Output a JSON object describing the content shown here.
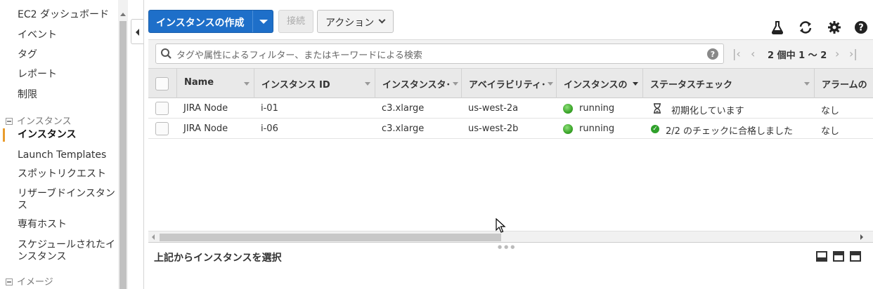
{
  "sidebar": {
    "items": [
      {
        "label": "EC2 ダッシュボード"
      },
      {
        "label": "イベント"
      },
      {
        "label": "タグ"
      },
      {
        "label": "レポート"
      },
      {
        "label": "制限"
      }
    ],
    "section_instances": "インスタンス",
    "instance_items": [
      {
        "label": "インスタンス"
      },
      {
        "label": "Launch Templates"
      },
      {
        "label": "スポットリクエスト"
      },
      {
        "label": "リザーブドインスタン"
      },
      {
        "label": "ス"
      },
      {
        "label": "専有ホスト"
      },
      {
        "label": "スケジュールされたイ"
      },
      {
        "label": "ンスタンス"
      }
    ],
    "section_images": "イメージ"
  },
  "toolbar": {
    "create_label": "インスタンスの作成",
    "connect_label": "接続",
    "actions_label": "アクション",
    "icons": [
      "flask-icon",
      "refresh-icon",
      "gear-icon",
      "help-icon"
    ]
  },
  "search": {
    "placeholder": "タグや属性によるフィルター、またはキーワードによる検索"
  },
  "pager": {
    "text": "2 個中 1 〜 2"
  },
  "table": {
    "columns": [
      "Name",
      "インスタンス ID",
      "インスタンスタ･",
      "アベイラビリティ･",
      "インスタンスの",
      "ステータスチェック",
      "アラームの"
    ],
    "rows": [
      {
        "name": "JIRA Node",
        "id": "i-01",
        "type": "c3.xlarge",
        "az": "us-west-2a",
        "state": "running",
        "status": "初期化しています",
        "alarm": "なし",
        "status_icon": "hourglass-icon"
      },
      {
        "name": "JIRA Node",
        "id": "i-06",
        "type": "c3.xlarge",
        "az": "us-west-2b",
        "state": "running",
        "status": "2/2 のチェックに合格しました",
        "alarm": "なし",
        "status_icon": "check-circle-icon"
      }
    ],
    "state_color": "#3ca52a"
  },
  "bottom_panel": {
    "title": "上記からインスタンスを選択"
  },
  "colors": {
    "primary": "#1e6fc9",
    "active_indicator": "#e99c2d"
  }
}
